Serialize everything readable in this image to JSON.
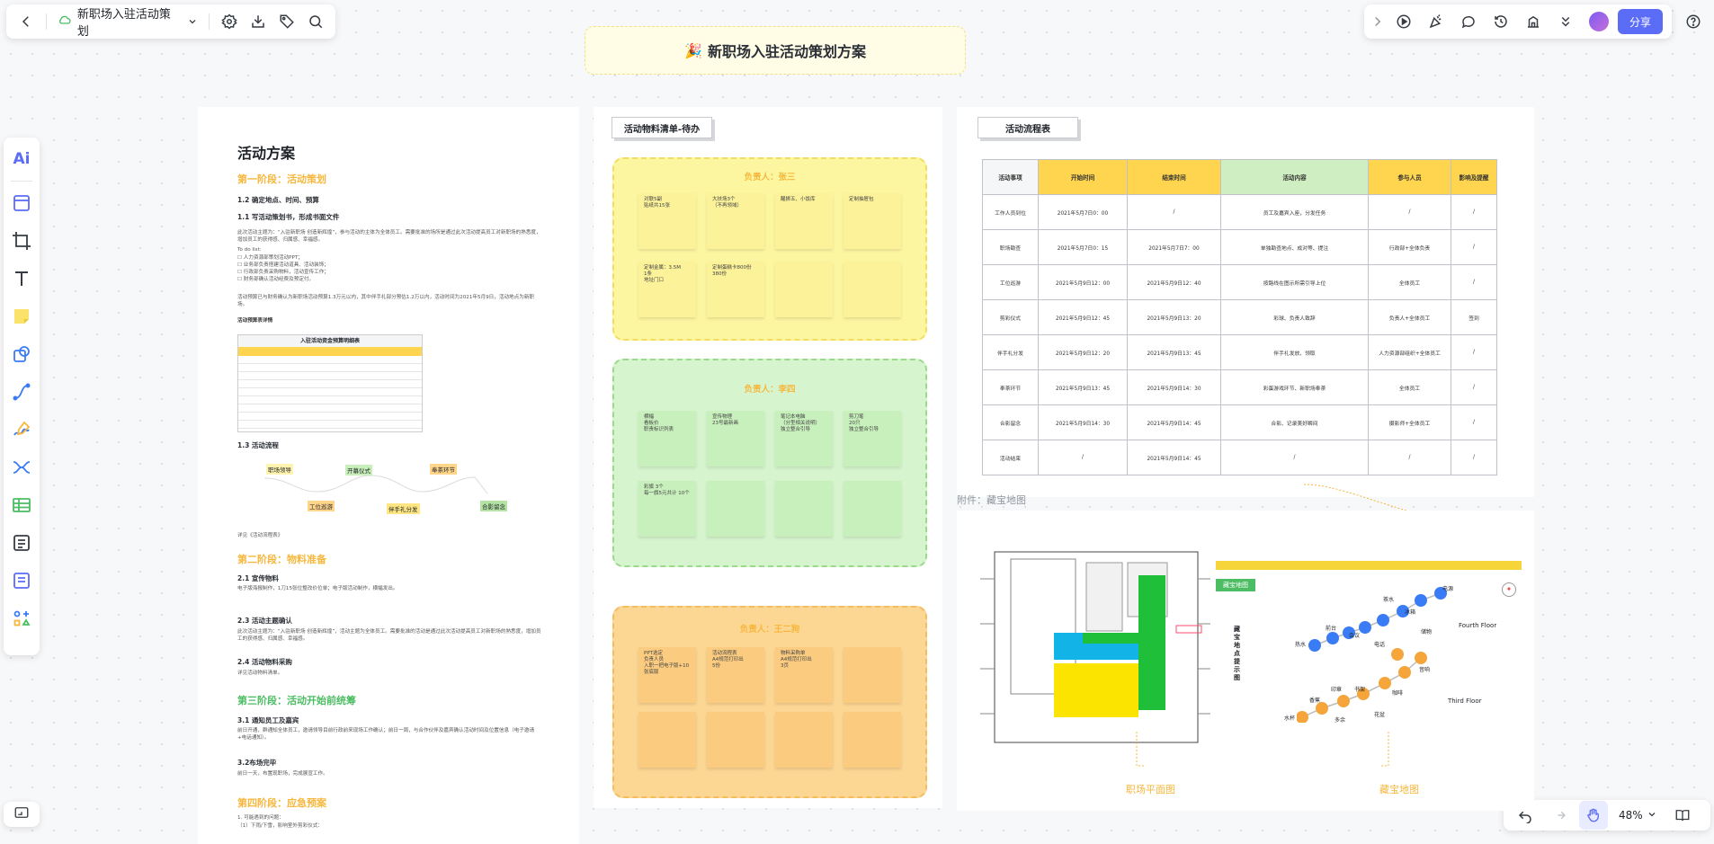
{
  "app": {
    "doc_title": "新职场入驻活动策划",
    "share_label": "分享",
    "zoom_label": "48%",
    "board_title": "新职场入驻活动策划方案",
    "board_title_emoji": "🎉",
    "colors": {
      "accent": "#5b6cf6",
      "yellow": "#fdf6a0",
      "green": "#d6f5ce",
      "orange": "#fcd693",
      "table_yellow": "#ffd54f",
      "table_green": "#cfeec2"
    }
  },
  "toolbar_left": {
    "icons": [
      "back-icon",
      "cloud-icon",
      "chevron-down-icon",
      "settings-icon",
      "download-icon",
      "tag-icon",
      "search-icon"
    ]
  },
  "toolbar_right": {
    "icons": [
      "collapse-icon",
      "present-icon",
      "celebrate-icon",
      "comment-icon",
      "history-icon",
      "stats-icon",
      "more-icon",
      "avatar-icon",
      "help-icon"
    ]
  },
  "tool_rail": {
    "ai_label": "Ai",
    "icons": [
      "frame-icon",
      "crop-icon",
      "text-icon",
      "sticky-note-icon",
      "shape-icon",
      "connector-icon",
      "pen-icon",
      "mindmap-icon",
      "table-icon",
      "doc-card-icon",
      "list-card-icon",
      "more-tools-icon"
    ]
  },
  "doc_panel": {
    "title": "活动方案",
    "stage1": "第一阶段：活动策划",
    "s1_2": "1.2 确定地点、时间、预算",
    "s1_1": "1.1 写活动策划书，形成书面文件",
    "s1_text": "此次活动主题为：“入驻新职场 创造新辉煌”，参与活动的主体为全体员工。需要批准的场所是通过此次活动提高员工对新职场的熟悉度，增加员工的获得感、归属感、幸福感。",
    "todo_title": "To do list:",
    "todos": [
      "人力资源部策划活动PPT；",
      "业务部负责搭建活动道具、活动装饰；",
      "行政部负责采购物料，活动宣传工作；",
      "财务部确认活动经费及预定付。"
    ],
    "budget_text": "活动预算已与财务确认为新职场活动预算1.3万元以内，其中伴手礼部分预估1.2万以内，活动时间为2021年5月9日，活动地点为新职场。",
    "budget_link": "活动预算表详情",
    "budget_table_title": "入驻活动资金预算明细表",
    "s1_3": "1.3 活动流程",
    "flow_nodes": [
      "职场领导",
      "开幕仪式",
      "奉茶环节",
      "工位巡游",
      "伴手礼分发",
      "合影留念"
    ],
    "flow_link": "详见《活动流程表》",
    "stage2": "第二阶段：物料准备",
    "s2_1": "2.1 宣传物料",
    "s2_1_text": "电子版海报制作，1刀15张位整改价位单；电子版活动制作，横幅发出。",
    "s2_3": "2.3 活动主题确认",
    "s2_3_text": "此次活动主题为：“入驻新职场 创造新辉煌”，活动主题为全体员工。需要批准的活动是通过此次活动提高员工对新职场的熟悉度，增加员工的获得感、归属感、幸福感。",
    "s2_4": "2.4 活动物料采购",
    "s2_4_text": "详见活动物料清单。",
    "stage3": "第三阶段：活动开始前统筹",
    "s3_1": "3.1 通知员工及嘉宾",
    "s3_1_text": "前日开通，群通知全体员工，邀请领导目前行政前来现场工作确认；前日一周，与合作伙伴及嘉宾确认活动时间及位置信息（电子邀请+电话通知）。",
    "s3_2": "3.2布场完毕",
    "s3_2_text": "前日一天，布置现职场，完成展宣工作。",
    "stage4": "第四阶段：应急预案",
    "s4_list": [
      "1. 可能遇到的问题：",
      "（1）下雨/下雪，影响室外剪彩仪式："
    ]
  },
  "materials": {
    "header": "活动物料清单-待办",
    "groups": [
      {
        "owner": "负责人：张三",
        "notes": [
          "对联5副\n贴纸共15张",
          "大扶场3个\n（不再领域）",
          "醒狮五、小饭库",
          "定制抽屉包",
          "定制金属：3.5M\n1条\n地址门口",
          "定制蛋糕卡800份\n380份",
          "",
          ""
        ]
      },
      {
        "owner": "负责人：李四",
        "notes": [
          "横幅\n看板价\n职责标识列表",
          "宣传物理\n23号最新画",
          "笔记本电脑\n（分型相关说明）\n独立整合引导",
          "剪刀笔\n20只\n独立整合引导",
          "彩旗 3个\n每一旗5元共计 10个",
          "",
          "",
          ""
        ]
      },
      {
        "owner": "负责人：王二狗",
        "notes": [
          "PPT选定\n负责人员\n入职一把电子版+10张底版",
          "活动流程表\n A4规范打印出\n5份",
          "物料采购单\nA4规范打印出\n3页",
          "",
          "",
          "",
          "",
          ""
        ]
      }
    ]
  },
  "schedule": {
    "header": "活动流程表",
    "columns": [
      "活动事项",
      "开始时间",
      "结束时间",
      "活动内容",
      "参与人员",
      "影响及提醒"
    ],
    "rows": [
      [
        "工作人员到位",
        "2021年5月7日0：00",
        "/",
        "员工及嘉宾入座，分发任务",
        "/",
        "/"
      ],
      [
        "职场勘查",
        "2021年5月7日0：15",
        "2021年5月7日7：00",
        "单独勘查地点、成对等、提注",
        "行政部+全体负责",
        "/"
      ],
      [
        "工位巡游",
        "2021年5月9日12：00",
        "2021年5月9日12：40",
        "按路线在图示所需引导上位",
        "全体员工",
        "/"
      ],
      [
        "剪彩仪式",
        "2021年5月9日12：45",
        "2021年5月9日13：20",
        "彩球、负责人致辞",
        "负责人+全体员工",
        "签到"
      ],
      [
        "伴手礼分发",
        "2021年5月9日12：20",
        "2021年5月9日13：45",
        "伴手礼发放、领取",
        "人力资源部组织+全体员工",
        "/"
      ],
      [
        "奉茶环节",
        "2021年5月9日13：45",
        "2021年5月9日14：30",
        "彩蛋游戏环节、新职场奉茶",
        "全体员工",
        "/"
      ],
      [
        "合影留念",
        "2021年5月9日14：30",
        "2021年5月9日14：45",
        "合影、记录美好瞬间",
        "摄影师+全体员工",
        "/"
      ],
      [
        "活动结束",
        "/",
        "2021年5月9日14：45",
        "/",
        "/",
        "/"
      ]
    ]
  },
  "map_panel": {
    "caption": "附件：藏宝地图",
    "floor_label": "职场平面图",
    "treasure_label": "藏宝地图",
    "treasure_title": "藏宝地图",
    "treasure_vertical": "藏宝地点提示图",
    "fourth_floor": "Fourth Floor",
    "third_floor": "Third Floor",
    "spots_upper": [
      "热水",
      "前台",
      "冰箱",
      "储物",
      "电源",
      "茶水",
      "电话",
      "会议"
    ],
    "spots_lower": [
      "水杯",
      "香蕉",
      "书架",
      "多余",
      "印章",
      "咖啡",
      "花盆",
      "音响"
    ]
  }
}
